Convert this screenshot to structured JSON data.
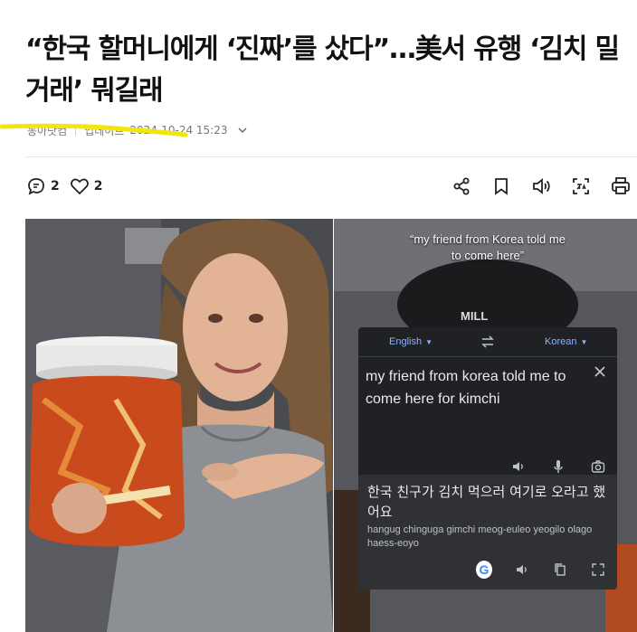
{
  "article": {
    "headline": "“한국 할머니에게 ‘진짜’를 샀다”…美서 유행 ‘김치 밀거래’ 뭐길래",
    "reporter": "동아닷컴",
    "updated_label": "업데이트",
    "updated_at": "2024-10-24 15:23"
  },
  "actions": {
    "comments_count": "2",
    "likes_count": "2"
  },
  "video": {
    "caption": "“my friend from Korea told me to come here”",
    "cap_brand": "MILL",
    "translate": {
      "source_lang": "English",
      "target_lang": "Korean",
      "source_text": "my friend from korea told me to come here for kimchi",
      "translated_text": "한국 친구가 김치 먹으러 여기로 오라고 했어요",
      "romanization": "hangug chinguga gimchi meog-euleo yeogilo olago haess-eoyo"
    }
  },
  "colors": {
    "highlight": "#f2e60a",
    "translate_bg": "#202124",
    "translate_result_bg": "#303134",
    "link_blue": "#8ab4f8"
  }
}
